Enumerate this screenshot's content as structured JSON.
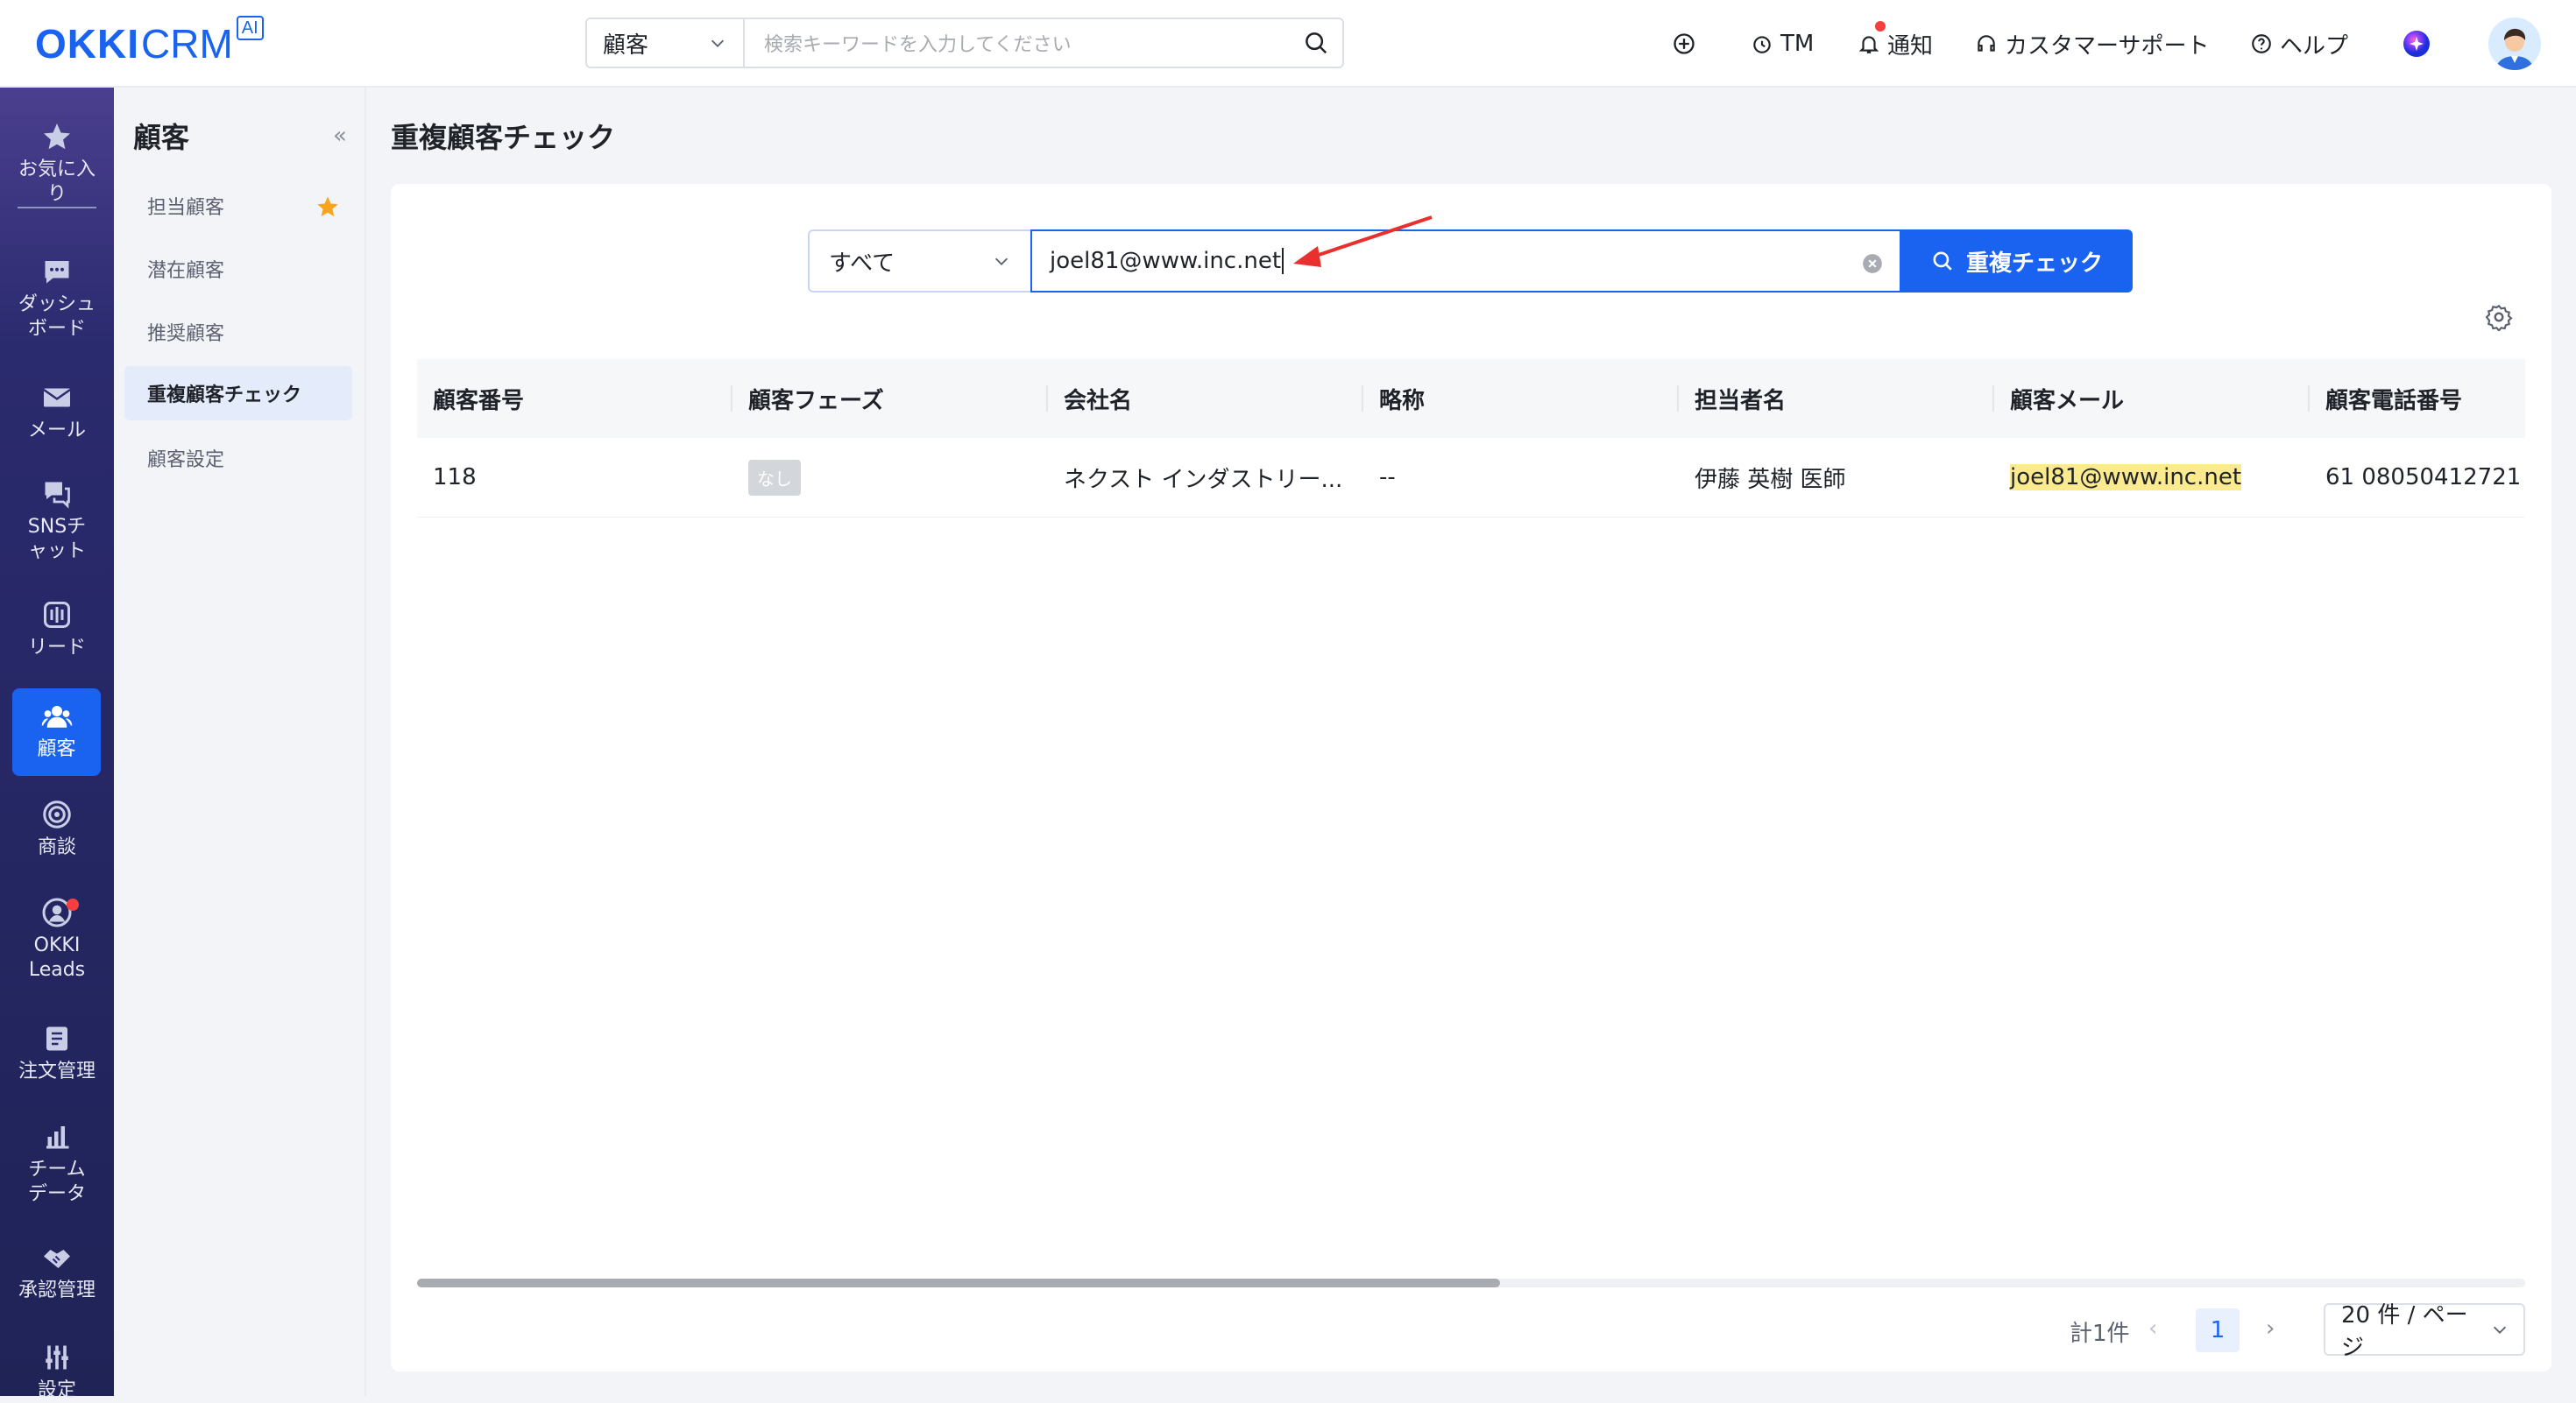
{
  "app": {
    "logo_main": "OKKI",
    "logo_sub": "CRM",
    "logo_badge": "AI"
  },
  "header": {
    "search_scope": "顧客",
    "search_placeholder": "検索キーワードを入力してください",
    "tm_label": "TM",
    "notify_label": "通知",
    "support_label": "カスタマーサポート",
    "help_label": "ヘルプ"
  },
  "rail": {
    "favorites": "お気に入り",
    "dashboard": "ダッシュボード",
    "mail": "メール",
    "sns": "SNSチャット",
    "lead": "リード",
    "customer": "顧客",
    "deals": "商談",
    "okki_leads": "OKKI Leads",
    "orders": "注文管理",
    "team_data": "チームデータ",
    "approval": "承認管理",
    "settings": "設定"
  },
  "subnav": {
    "title": "顧客",
    "collapse": "«",
    "items": [
      {
        "label": "担当顧客"
      },
      {
        "label": "潜在顧客"
      },
      {
        "label": "推奨顧客"
      },
      {
        "label": "重複顧客チェック"
      },
      {
        "label": "顧客設定"
      }
    ]
  },
  "page": {
    "title": "重複顧客チェック"
  },
  "dup_search": {
    "scope": "すべて",
    "value": "joel81@www.inc.net",
    "button_label": "重複チェック"
  },
  "table": {
    "columns": [
      "顧客番号",
      "顧客フェーズ",
      "会社名",
      "略称",
      "担当者名",
      "顧客メール",
      "顧客電話番号"
    ],
    "rows": [
      {
        "id": "118",
        "phase": "なし",
        "company": "ネクスト インダストリー...",
        "short_name": "--",
        "contact": "伊藤 英樹 医師",
        "email": "joel81@www.inc.net",
        "phone": "61 08050412721"
      }
    ]
  },
  "pagination": {
    "total": "計1件",
    "current_page": "1",
    "per_page": "20 件 / ページ"
  },
  "colors": {
    "brand": "#1a63f0",
    "rail_bg": "#1f2356",
    "highlight": "#fbeb8e",
    "annotation_arrow": "#e8312f",
    "notify_dot": "#f53f3f"
  }
}
